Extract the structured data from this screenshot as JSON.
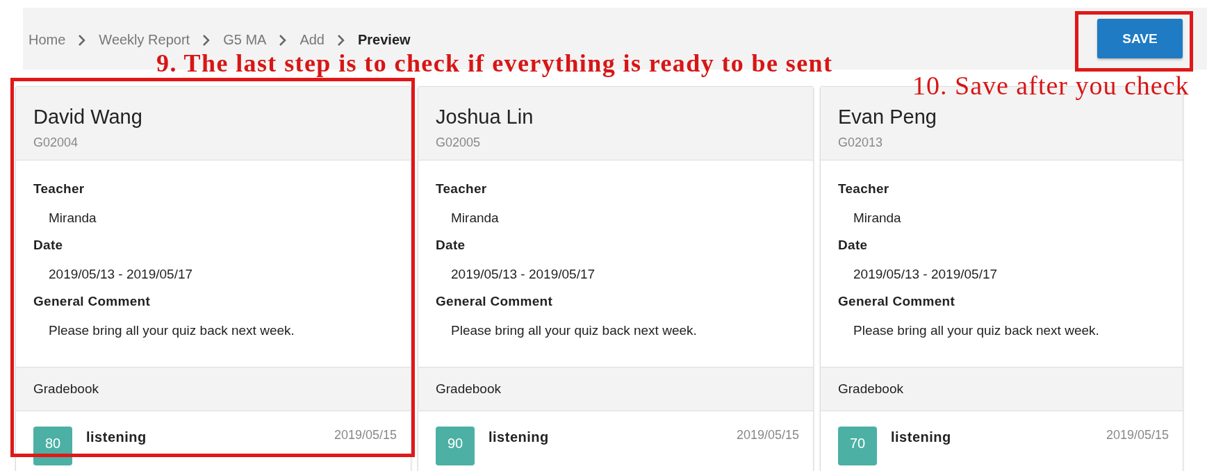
{
  "breadcrumb": [
    {
      "label": "Home",
      "selected": false
    },
    {
      "label": "Weekly Report",
      "selected": false
    },
    {
      "label": "G5 MA",
      "selected": false
    },
    {
      "label": "Add",
      "selected": false
    },
    {
      "label": "Preview",
      "selected": true
    }
  ],
  "save_button": {
    "label": "SAVE"
  },
  "annotations": [
    {
      "kind": "step",
      "text": "9. The last step is to check if everything is ready to be sent"
    },
    {
      "kind": "save",
      "text": "10. Save after you check"
    }
  ],
  "cards": [
    {
      "name": "David Wang",
      "id": "G02004",
      "fields": [
        {
          "label": "Teacher",
          "value": "Miranda"
        },
        {
          "label": "Date",
          "value": "2019/05/13 - 2019/05/17"
        },
        {
          "label": "General Comment",
          "value": "Please bring all your quiz back next week."
        }
      ],
      "gradebook_title": "Gradebook",
      "grades": [
        {
          "score": "80",
          "title": "listening",
          "date": "2019/05/15"
        }
      ]
    },
    {
      "name": "Joshua Lin",
      "id": "G02005",
      "fields": [
        {
          "label": "Teacher",
          "value": "Miranda"
        },
        {
          "label": "Date",
          "value": "2019/05/13 - 2019/05/17"
        },
        {
          "label": "General Comment",
          "value": "Please bring all your quiz back next week."
        }
      ],
      "gradebook_title": "Gradebook",
      "grades": [
        {
          "score": "90",
          "title": "listening",
          "date": "2019/05/15"
        }
      ]
    },
    {
      "name": "Evan Peng",
      "id": "G02013",
      "fields": [
        {
          "label": "Teacher",
          "value": "Miranda"
        },
        {
          "label": "Date",
          "value": "2019/05/13 - 2019/05/17"
        },
        {
          "label": "General Comment",
          "value": "Please bring all your quiz back next week."
        }
      ],
      "gradebook_title": "Gradebook",
      "grades": [
        {
          "score": "70",
          "title": "listening",
          "date": "2019/05/15"
        }
      ]
    }
  ]
}
